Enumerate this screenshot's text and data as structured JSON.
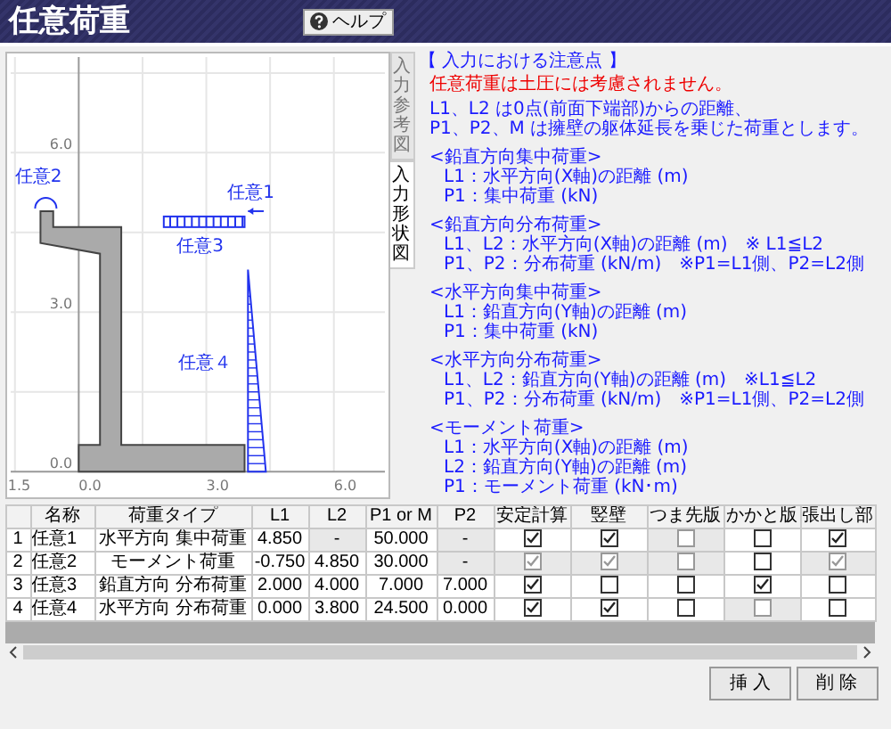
{
  "window": {
    "title": "任意荷重",
    "help_button": "ヘルプ"
  },
  "chart": {
    "x_ticks": [
      "1.5",
      "0.0",
      "3.0",
      "6.0"
    ],
    "y_ticks": [
      "6.0",
      "3.0",
      "0.0"
    ],
    "load_labels": [
      "任意1",
      "任意2",
      "任意3",
      "任意４"
    ]
  },
  "side_tabs": [
    {
      "label": "入力参考図",
      "selected": false
    },
    {
      "label": "入力形状図",
      "selected": true
    }
  ],
  "notes": {
    "heading": "【 入力における注意点 】",
    "warning": "任意荷重は土圧には考慮されません。",
    "intro": [
      "L1、L2 は0点(前面下端部)からの距離、",
      "P1、P2、M は擁壁の躯体延長を乗じた荷重とします。"
    ],
    "sections": [
      {
        "title": "<鉛直方向集中荷重>",
        "lines": [
          "L1：水平方向(X軸)の距離 (m)",
          "P1：集中荷重 (kN)"
        ]
      },
      {
        "title": "<鉛直方向分布荷重>",
        "lines": [
          "L1、L2：水平方向(X軸)の距離 (m)　※ L1≦L2",
          "P1、P2：分布荷重 (kN/m)　※P1=L1側、P2=L2側"
        ]
      },
      {
        "title": "<水平方向集中荷重>",
        "lines": [
          "L1：鉛直方向(Y軸)の距離 (m)",
          "P1：集中荷重 (kN)"
        ]
      },
      {
        "title": "<水平方向分布荷重>",
        "lines": [
          "L1、L2：鉛直方向(Y軸)の距離 (m)　※L1≦L2",
          "P1、P2：分布荷重 (kN/m)　※P1=L1側、P2=L2側"
        ]
      },
      {
        "title": "<モーメント荷重>",
        "lines": [
          "L1：水平方向(X軸)の距離 (m)",
          "L2：鉛直方向(Y軸)の距離 (m)",
          "P1：モーメント荷重 (kN･m)"
        ]
      }
    ]
  },
  "table": {
    "columns": [
      "名称",
      "荷重タイプ",
      "L1",
      "L2",
      "P1 or M",
      "P2",
      "安定計算",
      "竪壁",
      "つま先版",
      "かかと版",
      "張出し部"
    ],
    "rows": [
      {
        "number": "1",
        "cells": [
          {
            "text": "任意1",
            "disabled": false
          },
          {
            "text": "水平方向 集中荷重",
            "disabled": false
          },
          {
            "text": "4.850",
            "disabled": false
          },
          {
            "text": "-",
            "disabled": true
          },
          {
            "text": "50.000",
            "disabled": false
          },
          {
            "text": "-",
            "disabled": true
          }
        ],
        "checks": [
          {
            "checked": true,
            "disabled": false
          },
          {
            "checked": true,
            "disabled": false
          },
          {
            "checked": false,
            "disabled": true
          },
          {
            "checked": false,
            "disabled": false
          },
          {
            "checked": true,
            "disabled": false
          }
        ]
      },
      {
        "number": "2",
        "cells": [
          {
            "text": "任意2",
            "disabled": false
          },
          {
            "text": "モーメント荷重",
            "disabled": false
          },
          {
            "text": "-0.750",
            "disabled": false
          },
          {
            "text": "4.850",
            "disabled": false
          },
          {
            "text": "30.000",
            "disabled": false
          },
          {
            "text": "-",
            "disabled": true
          }
        ],
        "checks": [
          {
            "checked": true,
            "disabled": true
          },
          {
            "checked": true,
            "disabled": true
          },
          {
            "checked": false,
            "disabled": true
          },
          {
            "checked": false,
            "disabled": false
          },
          {
            "checked": true,
            "disabled": true
          }
        ]
      },
      {
        "number": "3",
        "cells": [
          {
            "text": "任意3",
            "disabled": false
          },
          {
            "text": "鉛直方向 分布荷重",
            "disabled": false
          },
          {
            "text": "2.000",
            "disabled": false
          },
          {
            "text": "4.000",
            "disabled": false
          },
          {
            "text": "7.000",
            "disabled": false
          },
          {
            "text": "7.000",
            "disabled": false
          }
        ],
        "checks": [
          {
            "checked": true,
            "disabled": false
          },
          {
            "checked": false,
            "disabled": false
          },
          {
            "checked": false,
            "disabled": false
          },
          {
            "checked": true,
            "disabled": false
          },
          {
            "checked": false,
            "disabled": false
          }
        ]
      },
      {
        "number": "4",
        "cells": [
          {
            "text": "任意4",
            "disabled": false
          },
          {
            "text": "水平方向 分布荷重",
            "disabled": false
          },
          {
            "text": "0.000",
            "disabled": false
          },
          {
            "text": "3.800",
            "disabled": false
          },
          {
            "text": "24.500",
            "disabled": false
          },
          {
            "text": "0.000",
            "disabled": false
          }
        ],
        "checks": [
          {
            "checked": true,
            "disabled": false
          },
          {
            "checked": true,
            "disabled": false
          },
          {
            "checked": false,
            "disabled": false
          },
          {
            "checked": false,
            "disabled": true
          },
          {
            "checked": false,
            "disabled": false
          }
        ]
      }
    ]
  },
  "buttons": [
    "挿 入",
    "削 除"
  ]
}
